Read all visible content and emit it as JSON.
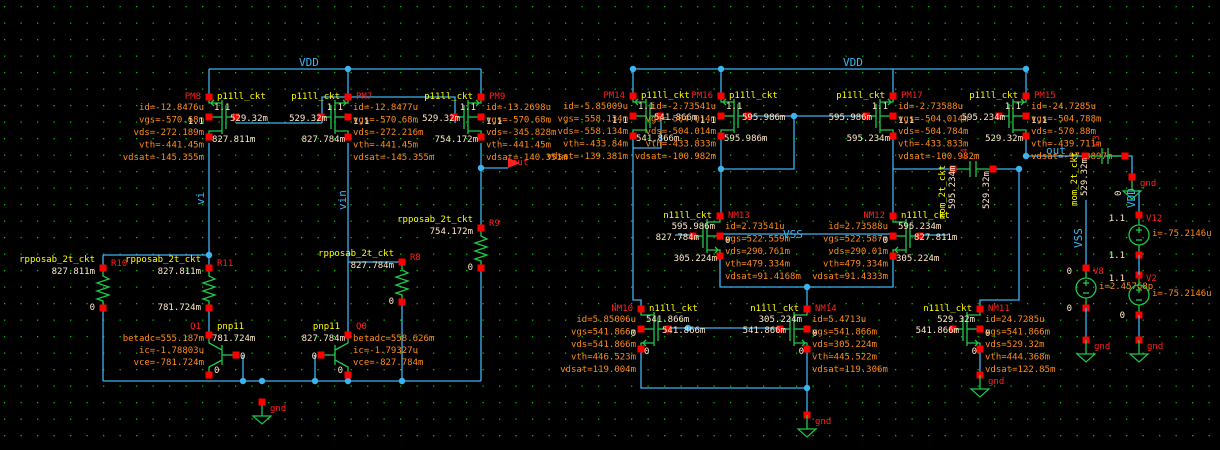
{
  "colors": {
    "background": "#000000",
    "wire": "#3cb4f0",
    "pin": "#ff0000",
    "symbol": "#1fc84a",
    "instance_name": "#ff2020",
    "model": "#ffff00",
    "parameter": "#ff8c1a",
    "node_voltage": "#ffe8c8",
    "grid": "#00c000"
  },
  "nets": {
    "vdd_left": "VDD",
    "vdd_right": "VDD",
    "vss": "VSS",
    "vdd_src": "VDD",
    "vss_src": "VSS",
    "vi": "vi",
    "vin": "vin",
    "out_left": "out",
    "out_right": "out",
    "gnd": "gnd"
  },
  "transistors": [
    {
      "name": "PM8",
      "model": "p11ll_ckt",
      "params": [
        "id=-12.8476u",
        "vgs=-570.68m",
        "vds=-272.189m",
        "vth=-441.45m",
        "vdsat=-145.355m"
      ],
      "nodes": [
        "1.1",
        "1.1",
        "529.32m",
        "827.811m"
      ]
    },
    {
      "name": "PM7",
      "model": "p11ll_ckt",
      "params": [
        "id=-12.8477u",
        "vgs=-570.68m",
        "vds=-272.216m",
        "vth=-441.45m",
        "vdsat=-145.355m"
      ],
      "nodes": [
        "1.1",
        "1.1",
        "529.32m",
        "827.784m"
      ]
    },
    {
      "name": "PM9",
      "model": "p11ll_ckt",
      "params": [
        "id=-13.2698u",
        "vgs=-570.68m",
        "vds=-345.828m",
        "vth=-441.45m",
        "vdsat=-140.351m"
      ],
      "nodes": [
        "1.1",
        "1.1",
        "529.32m",
        "754.172m"
      ]
    },
    {
      "name": "PM14",
      "model": "p11ll_ckt",
      "params": [
        "id=-5.85009u",
        "vgs=-558.134m",
        "vds=-558.134m",
        "vth=-433.84m",
        "vdsat=-139.381m"
      ],
      "nodes": [
        "1.1",
        "1.1",
        "541.866m",
        "541.866m"
      ]
    },
    {
      "name": "PM16",
      "model": "p11ll_ckt",
      "params": [
        "id=-2.73541u",
        "vgs=-504.014m",
        "vds=-504.014m",
        "vth=-433.833m",
        "vdsat=-100.982m"
      ],
      "nodes": [
        "1.1",
        "1.1",
        "595.986m",
        "595.986m"
      ]
    },
    {
      "name": "PM17",
      "model": "p11ll_ckt",
      "params": [
        "id=-2.73588u",
        "vgs=-504.014m",
        "vds=-504.784m",
        "vth=-433.833m",
        "vdsat=-100.982m"
      ],
      "nodes": [
        "1.1",
        "1.1",
        "595.986m",
        "595.234m"
      ]
    },
    {
      "name": "PM15",
      "model": "p11ll_ckt",
      "params": [
        "id=-24.7285u",
        "vgs=-504.788m",
        "vds=-570.88m",
        "vth=-439.711m",
        "vdsat=-97.3897m"
      ],
      "nodes": [
        "1.1",
        "1.1",
        "595.234m",
        "529.32m"
      ]
    },
    {
      "name": "NM13",
      "model": "n11ll_ckt",
      "params": [
        "id=2.73541u",
        "vgs=522.559m",
        "vds=290.761m",
        "vth=479.334m",
        "vdsat=91.4168m"
      ],
      "nodes": [
        "595.986m",
        "0",
        "827.784m",
        "305.224m"
      ]
    },
    {
      "name": "NM12",
      "model": "n11ll_ckt",
      "params": [
        "id=2.73588u",
        "vgs=522.587m",
        "vds=290.01m",
        "vth=479.334m",
        "vdsat=91.4333m"
      ],
      "nodes": [
        "595.234m",
        "0",
        "827.811m",
        "305.224m"
      ]
    },
    {
      "name": "NM10",
      "model": "n11ll_ckt",
      "params": [
        "id=5.85006u",
        "vgs=541.866m",
        "vds=541.866m",
        "vth=446.523m",
        "vdsat=119.004m"
      ],
      "nodes": [
        "541.866m",
        "0",
        "541.866m",
        "0"
      ]
    },
    {
      "name": "NM14",
      "model": "n11ll_ckt",
      "params": [
        "id=5.4713u",
        "vgs=541.866m",
        "vds=305.224m",
        "vth=445.522m",
        "vdsat=119.306m"
      ],
      "nodes": [
        "305.224m",
        "0",
        "541.866m",
        "0"
      ]
    },
    {
      "name": "NM11",
      "model": "n11ll_ckt",
      "params": [
        "id=24.7285u",
        "vgs=541.866m",
        "vds=529.32m",
        "vth=444.368m",
        "vdsat=122.85m"
      ],
      "nodes": [
        "529.32m",
        "0",
        "541.866m",
        "0"
      ]
    }
  ],
  "resistors": [
    {
      "name": "R10",
      "model": "rpposab_2t_ckt",
      "nodes": [
        "827.811m",
        "0"
      ]
    },
    {
      "name": "R11",
      "model": "rpposab_2t_ckt",
      "nodes": [
        "827.811m",
        "781.724m"
      ]
    },
    {
      "name": "R8",
      "model": "rpposab_2t_ckt",
      "nodes": [
        "827.784m",
        "0"
      ]
    },
    {
      "name": "R9",
      "model": "rpposab_2t_ckt",
      "nodes": [
        "754.172m",
        "0"
      ]
    }
  ],
  "bjts": [
    {
      "name": "Q1",
      "model": "pnp11",
      "params": [
        "betadc=555.187m",
        "ic=-1.78803u",
        "vce=-781.724m"
      ],
      "nodes": [
        "781.724m",
        "0",
        "0"
      ]
    },
    {
      "name": "Q0",
      "model": "pnp11",
      "params": [
        "betadc=558.626m",
        "ic=-1.79327u",
        "vce=-827.784m"
      ],
      "nodes": [
        "827.784m",
        "0",
        "0"
      ]
    }
  ],
  "capacitors": [
    {
      "name": "C4",
      "model": "mom_2t_ckt",
      "nodes": [
        "595.234m",
        "529.32m"
      ]
    },
    {
      "name": "C3",
      "model": "mom_2t_ckt",
      "nodes": [
        "529.32m",
        "0"
      ]
    }
  ],
  "sources": [
    {
      "name": "V12",
      "params": "i=-75.2146u",
      "nodes": [
        "1.1",
        "1.1"
      ]
    },
    {
      "name": "V8",
      "params": "i=2.45768p",
      "nodes": [
        "0",
        "0"
      ]
    },
    {
      "name": "V2",
      "params": "i=-75.2146u",
      "nodes": [
        "1.1",
        "0"
      ]
    }
  ]
}
